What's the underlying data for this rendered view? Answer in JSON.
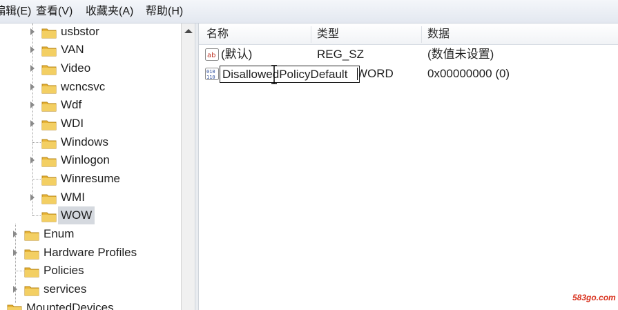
{
  "menubar": {
    "items": [
      "编辑(E)",
      "查看(V)",
      "收藏夹(A)",
      "帮助(H)"
    ]
  },
  "tree": {
    "items": [
      {
        "label": "usbstor"
      },
      {
        "label": "VAN"
      },
      {
        "label": "Video"
      },
      {
        "label": "wcncsvc"
      },
      {
        "label": "Wdf"
      },
      {
        "label": "WDI"
      },
      {
        "label": "Windows"
      },
      {
        "label": "Winlogon"
      },
      {
        "label": "Winresume"
      },
      {
        "label": "WMI"
      },
      {
        "label": "WOW"
      },
      {
        "label": "Enum"
      },
      {
        "label": "Hardware Profiles"
      },
      {
        "label": "Policies"
      },
      {
        "label": "services"
      },
      {
        "label": "MountedDevices"
      }
    ],
    "selected": "WOW"
  },
  "list": {
    "columns": [
      "名称",
      "类型",
      "数据"
    ],
    "rows": [
      {
        "name": "(默认)",
        "type": "REG_SZ",
        "data": "(数值未设置)",
        "icon": "string-value-icon"
      },
      {
        "name": "DisallowedPolicyDefault",
        "type": "REG_DWORD",
        "type_visible": "WORD",
        "data": "0x00000000 (0)",
        "icon": "dword-value-icon"
      }
    ]
  },
  "watermark": "583go.com",
  "colors": {
    "folder": "#e8b437",
    "selection": "#d5d9df",
    "watermark": "#d9331f"
  }
}
